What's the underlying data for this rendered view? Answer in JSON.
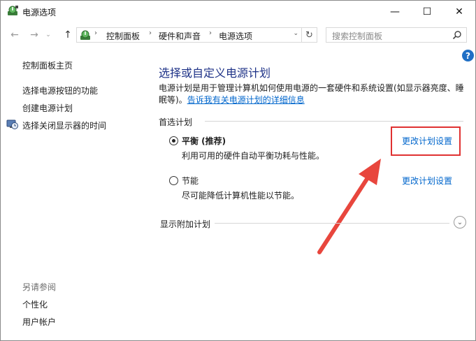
{
  "window": {
    "title": "电源选项",
    "minimize_glyph": "—",
    "maximize_glyph": "☐",
    "close_glyph": "✕"
  },
  "nav": {
    "back_glyph": "←",
    "forward_glyph": "→",
    "recent_glyph": "⌄",
    "up_glyph": "↑",
    "breadcrumb": [
      "控制面板",
      "硬件和声音",
      "电源选项"
    ],
    "separator_glyph": "›",
    "dropdown_glyph": "⌄",
    "refresh_glyph": "↻",
    "search_placeholder": "搜索控制面板"
  },
  "help": {
    "glyph": "?"
  },
  "sidebar": {
    "home_link": "控制面板主页",
    "items": [
      {
        "label": "选择电源按钮的功能"
      },
      {
        "label": "创建电源计划"
      },
      {
        "label": "选择关闭显示器的时间"
      }
    ],
    "see_also_heading": "另请参阅",
    "see_also": [
      {
        "label": "个性化"
      },
      {
        "label": "用户帐户"
      }
    ]
  },
  "main": {
    "title": "选择或自定义电源计划",
    "description_line1": "电源计划是用于管理计算机如何使用电源的一套硬件和系统设置(如显示器亮度、睡",
    "description_line2_prefix": "眠等)。",
    "description_link": "告诉我有关电源计划的详细信息",
    "preferred_plans_label": "首选计划",
    "plans": [
      {
        "name": "平衡 (推荐)",
        "description": "利用可用的硬件自动平衡功耗与性能。",
        "selected": true,
        "change_link": "更改计划设置"
      },
      {
        "name": "节能",
        "description": "尽可能降低计算机性能以节能。",
        "selected": false,
        "change_link": "更改计划设置"
      }
    ],
    "more_plans_label": "显示附加计划",
    "expand_glyph": "⌄"
  },
  "colors": {
    "title_blue": "#1e3287",
    "link_blue": "#0066cc",
    "highlight_red": "#e03131"
  }
}
